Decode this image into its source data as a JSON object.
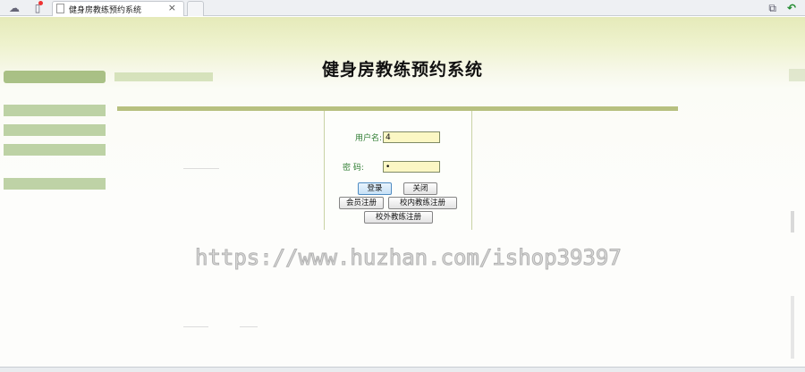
{
  "browser": {
    "tab_title": "健身房教练预约系统",
    "tab_close": "×"
  },
  "page": {
    "title": "健身房教练预约系统"
  },
  "login": {
    "username_label": "用户名:",
    "username_value": "4",
    "password_label": "密  码:",
    "password_value": "•",
    "login_button": "登录",
    "close_button": "关闭",
    "member_register_button": "会员注册",
    "inner_coach_register_button": "校内教练注册",
    "outer_coach_register_button": "校外教练注册"
  },
  "watermark": "https://www.huzhan.com/ishop39397",
  "colors": {
    "accent_olive": "#b7c080",
    "label_green": "#2f7d32",
    "input_yellow": "#fbf7c4"
  }
}
